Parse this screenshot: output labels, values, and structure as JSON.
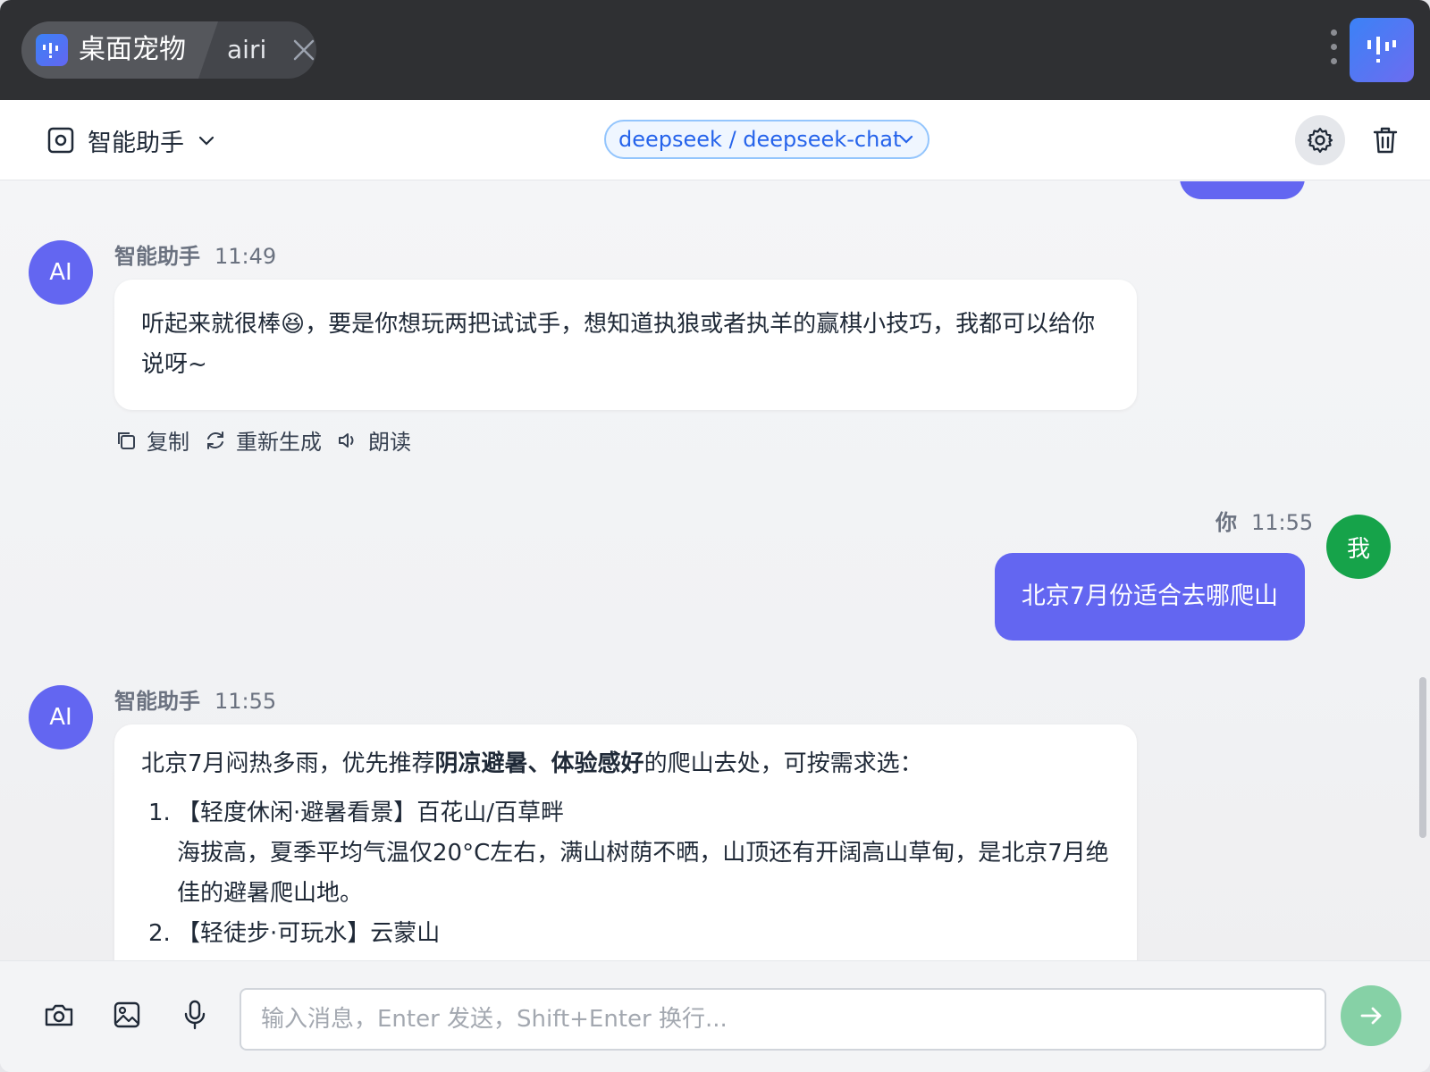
{
  "titlebar": {
    "tab_active_label": "桌面宠物",
    "tab_second_label": "airi"
  },
  "header": {
    "assistant_name": "智能助手",
    "model": "deepseek / deepseek-chat"
  },
  "messages": [
    {
      "role": "assistant",
      "avatar_label": "AI",
      "sender": "智能助手",
      "time": "11:49",
      "text": "听起来就很棒😆，要是你想玩两把试试手，想知道执狼或者执羊的赢棋小技巧，我都可以给你说呀~",
      "actions": {
        "copy": "复制",
        "regenerate": "重新生成",
        "read": "朗读"
      }
    },
    {
      "role": "user",
      "avatar_label": "我",
      "sender": "你",
      "time": "11:55",
      "text": "北京7月份适合去哪爬山"
    },
    {
      "role": "assistant",
      "avatar_label": "AI",
      "sender": "智能助手",
      "time": "11:55",
      "intro_pre": "北京7月闷热多雨，优先推荐",
      "intro_bold": "阴凉避暑、体验感好",
      "intro_post": "的爬山去处，可按需求选：",
      "items": [
        {
          "num": "1.",
          "title": "【轻度休闲·避暑看景】百花山/百草畔",
          "desc": "海拔高，夏季平均气温仅20°C左右，满山树荫不晒，山顶还有开阔高山草甸，是北京7月绝佳的避暑爬山地。"
        },
        {
          "num": "2.",
          "title": "【轻徒步·可玩水】云蒙山",
          "desc": ""
        }
      ]
    }
  ],
  "input": {
    "placeholder": "输入消息，Enter 发送，Shift+Enter 换行..."
  },
  "colors": {
    "accent": "#6366f1",
    "user_avatar": "#16a34a",
    "model_pill_text": "#2563eb",
    "send_button": "#86d1a6",
    "titlebar": "#2f3033"
  },
  "icons": {
    "assistant_select": "screen-record-icon",
    "settings": "gear-icon",
    "delete": "trash-icon",
    "camera": "camera-icon",
    "image": "image-icon",
    "mic": "microphone-icon",
    "send": "arrow-right-icon"
  }
}
